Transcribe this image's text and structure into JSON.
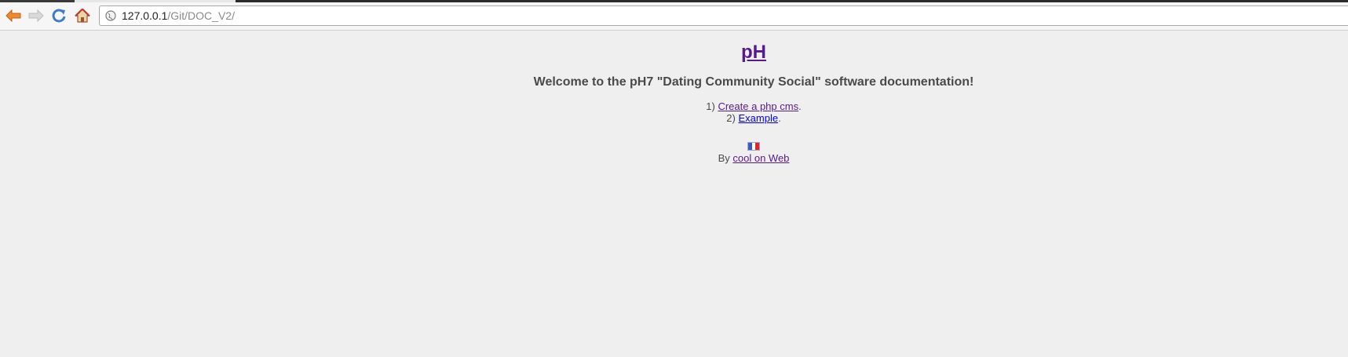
{
  "browser": {
    "url_host": "127.0.0.1",
    "url_path": "/Git/DOC_V2/",
    "icons": {
      "back": "back-arrow-icon",
      "forward": "forward-arrow-icon",
      "reload": "reload-icon",
      "home": "home-icon",
      "site": "globe-icon"
    }
  },
  "page": {
    "title": "pH",
    "welcome": "Welcome to the pH7 \"Dating Community Social\" software documentation!",
    "list": [
      {
        "number": "1)",
        "link": "Create a php cms",
        "suffix": "."
      },
      {
        "number": "2)",
        "link": "Example",
        "suffix": "."
      }
    ],
    "flag_icon": "french-flag-icon",
    "byline_prefix": "By",
    "byline_link": "cool on Web"
  },
  "colors": {
    "background": "#efefef",
    "visited_link": "#551a8b",
    "unvisited_link": "#0000ee",
    "text": "#4a4a4a"
  }
}
